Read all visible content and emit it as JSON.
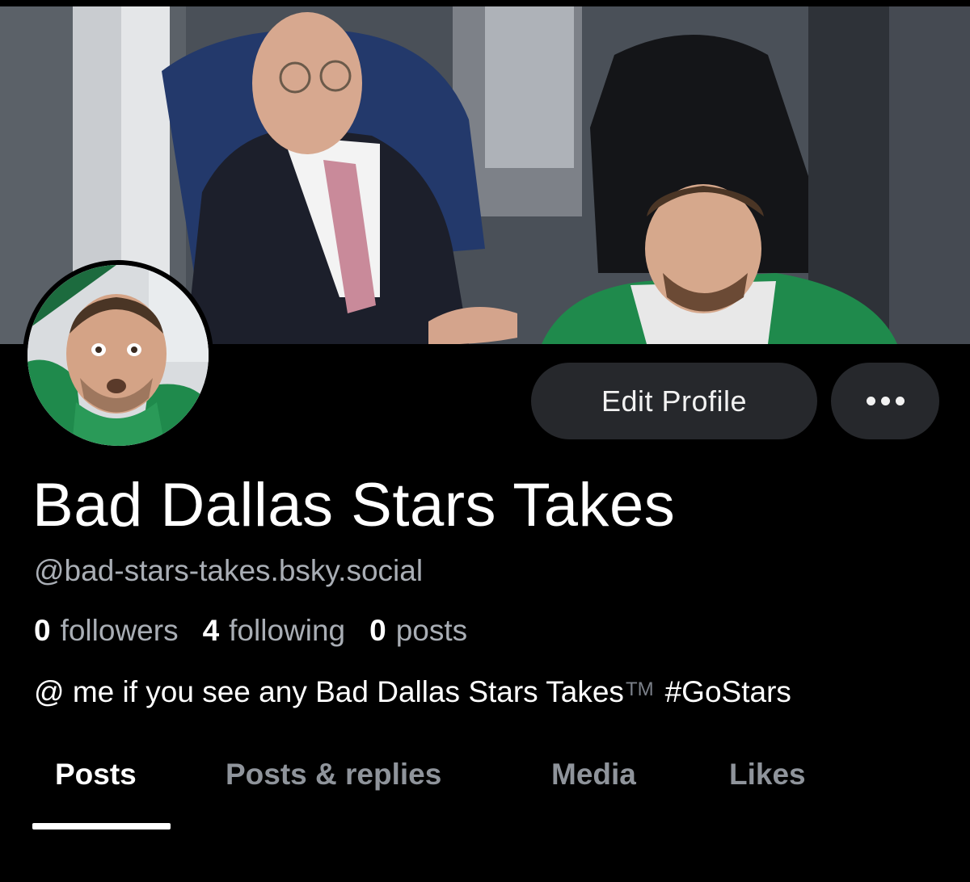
{
  "profile": {
    "display_name": "Bad Dallas Stars Takes",
    "handle": "@bad-stars-takes.bsky.social",
    "bio_text": "@ me if you see any Bad Dallas Stars Takes",
    "bio_tm": "TM",
    "bio_hashtag": "#GoStars"
  },
  "stats": {
    "followers_count": "0",
    "followers_label": "followers",
    "following_count": "4",
    "following_label": "following",
    "posts_count": "0",
    "posts_label": "posts"
  },
  "actions": {
    "edit_profile_label": "Edit Profile",
    "more_icon": "ellipsis-horizontal-icon"
  },
  "tabs": [
    {
      "label": "Posts",
      "active": true
    },
    {
      "label": "Posts & replies",
      "active": false
    },
    {
      "label": "Media",
      "active": false
    },
    {
      "label": "Likes",
      "active": false
    }
  ],
  "colors": {
    "background": "#000000",
    "button_bg": "#26282c",
    "muted_text": "#a9aeb5",
    "inactive_tab": "#8f949b",
    "stars_green": "#1f8a4c"
  }
}
